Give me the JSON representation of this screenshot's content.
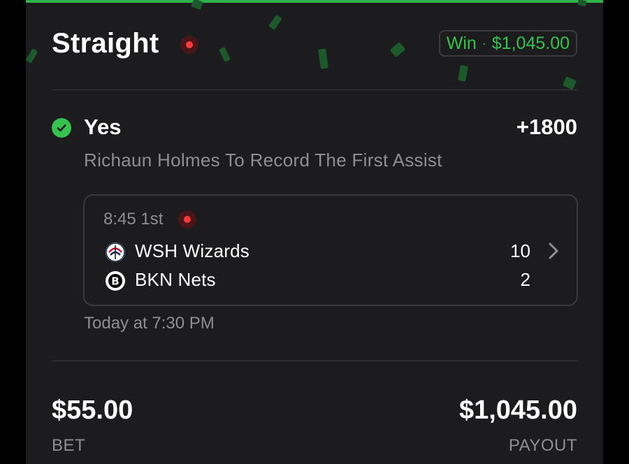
{
  "bet": {
    "type_title": "Straight",
    "live_indicator": "live",
    "status": {
      "result": "Win",
      "separator": "·",
      "amount": "$1,045.00"
    }
  },
  "selection": {
    "status_icon": "check-circle-icon",
    "name": "Yes",
    "odds": "+1800",
    "market": "Richaun Holmes To Record The First Assist"
  },
  "game": {
    "clock": "8:45 1st",
    "live_indicator": "live",
    "teams": [
      {
        "name": "WSH Wizards",
        "score": "10",
        "logo": "wizards-logo-icon"
      },
      {
        "name": "BKN Nets",
        "score": "2",
        "logo": "nets-logo-icon"
      }
    ],
    "start_time": "Today at 7:30 PM"
  },
  "totals": {
    "bet_amount": "$55.00",
    "bet_label": "BET",
    "payout_amount": "$1,045.00",
    "payout_label": "PAYOUT"
  },
  "colors": {
    "win_green": "#35c24e",
    "live_red": "#ff3b3b",
    "card_bg": "#1c1c1e",
    "muted_text": "#8e8e93"
  }
}
